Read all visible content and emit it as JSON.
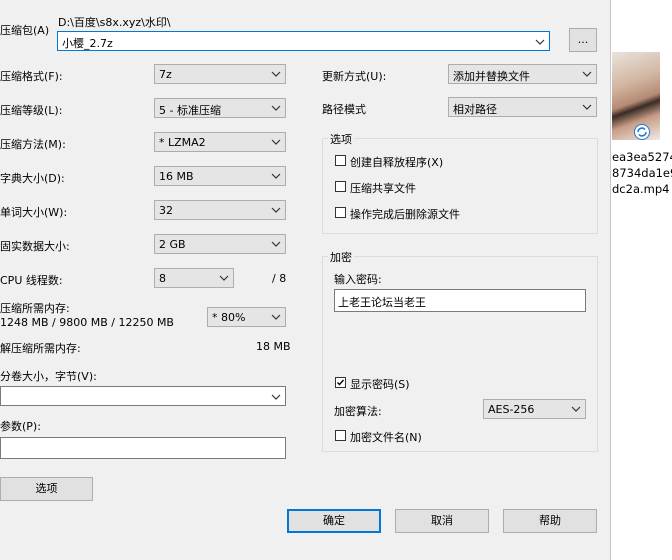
{
  "archive": {
    "label": "压缩包(A)",
    "path": "D:\\百度\\s8x.xyz\\水印\\",
    "filename": "小樱_2.7z",
    "browse_label": "..."
  },
  "left": {
    "format_label": "压缩格式(F):",
    "format_value": "7z",
    "level_label": "压缩等级(L):",
    "level_value": "5 - 标准压缩",
    "method_label": "压缩方法(M):",
    "method_value": "*  LZMA2",
    "dict_label": "字典大小(D):",
    "dict_value": "16 MB",
    "word_label": "单词大小(W):",
    "word_value": "32",
    "solid_label": "固实数据大小:",
    "solid_value": "2 GB",
    "cpu_label": "CPU 线程数:",
    "cpu_value": "8",
    "cpu_total": "/ 8",
    "mem_label": "压缩所需内存:",
    "mem_values": "1248 MB / 9800 MB / 12250 MB",
    "mem_percent": "* 80%",
    "decomp_label": "解压缩所需内存:",
    "decomp_value": "18 MB",
    "volume_label": "分卷大小，字节(V):",
    "params_label": "参数(P):",
    "options_button": "选项"
  },
  "right": {
    "update_label": "更新方式(U):",
    "update_value": "添加并替换文件",
    "path_label": "路径模式",
    "path_value": "相对路径",
    "options_group": "选项",
    "opt_sfx": "创建自释放程序(X)",
    "opt_shared": "压缩共享文件",
    "opt_delete": "操作完成后删除源文件",
    "encrypt_group": "加密",
    "password_label": "输入密码:",
    "password_value": "上老王论坛当老王",
    "show_password": "显示密码(S)",
    "method_label": "加密算法:",
    "method_value": "AES-256",
    "encrypt_names": "加密文件名(N)"
  },
  "buttons": {
    "ok": "确定",
    "cancel": "取消",
    "help": "帮助"
  },
  "background_file": {
    "name_line1": "ea3ea5274",
    "name_line2": "8734da1e9",
    "name_line3": "dc2a.mp4"
  }
}
